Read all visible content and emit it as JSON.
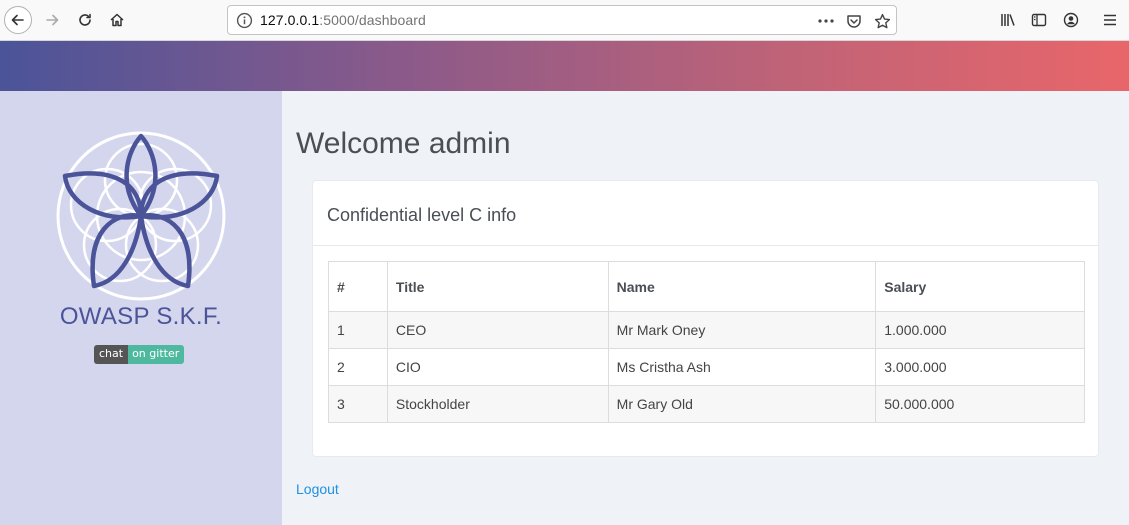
{
  "browser": {
    "url_host": "127.0.0.1",
    "url_path": ":5000/dashboard"
  },
  "sidebar": {
    "brand": "OWASP S.K.F.",
    "badge_left": "chat",
    "badge_right": "on gitter"
  },
  "main": {
    "welcome": "Welcome admin",
    "card_title": "Confidential level C info",
    "table": {
      "headers": [
        "#",
        "Title",
        "Name",
        "Salary"
      ],
      "rows": [
        [
          "1",
          "CEO",
          "Mr Mark Oney",
          "1.000.000"
        ],
        [
          "2",
          "CIO",
          "Ms Cristha Ash",
          "3.000.000"
        ],
        [
          "3",
          "Stockholder",
          "Mr Gary Old",
          "50.000.000"
        ]
      ]
    },
    "logout": "Logout"
  },
  "colors": {
    "banner_start": "#4b5499",
    "banner_end": "#e8666a",
    "sidebar_bg": "#d4d6ee",
    "main_bg": "#eff2f6",
    "link": "#1e90e6",
    "logo": "#4b5499"
  }
}
